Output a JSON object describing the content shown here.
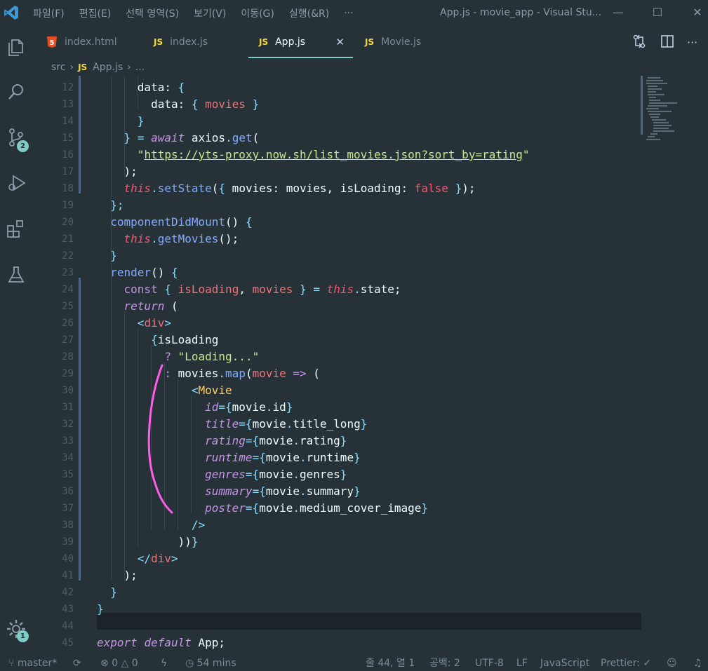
{
  "menu": [
    "파일(F)",
    "편집(E)",
    "선택 영역(S)",
    "보기(V)",
    "이동(G)",
    "실행(&R)",
    "···"
  ],
  "window_title": "App.js - movie_app - Visual Stu...",
  "window_controls": {
    "minimize": "—",
    "maximize": "☐",
    "close": "✕"
  },
  "activity_badges": {
    "source_control": "2",
    "settings": "1"
  },
  "tabs": [
    {
      "label": "index.html",
      "icon": "html5-icon"
    },
    {
      "label": "index.js",
      "icon": "js-icon",
      "icon_text": "JS"
    },
    {
      "label": "App.js",
      "icon": "js-icon",
      "icon_text": "JS",
      "active": true,
      "close": "✕"
    },
    {
      "label": "Movie.js",
      "icon": "js-icon",
      "icon_text": "JS"
    }
  ],
  "tab_more": "···",
  "breadcrumb": {
    "folder": "src",
    "sep1": "›",
    "icon_text": "JS",
    "file": "App.js",
    "sep2": "›",
    "more": "..."
  },
  "line_numbers": [
    "12",
    "13",
    "14",
    "15",
    "16",
    "17",
    "18",
    "19",
    "20",
    "21",
    "22",
    "23",
    "24",
    "25",
    "26",
    "27",
    "28",
    "29",
    "30",
    "31",
    "32",
    "33",
    "34",
    "35",
    "36",
    "37",
    "38",
    "39",
    "40",
    "41",
    "42",
    "43",
    "44",
    "45"
  ],
  "code": {
    "url": "https://yts-proxy.now.sh/list_movies.json?sort_by=rating",
    "loading": "\"Loading...\""
  },
  "status": {
    "branch": "master*",
    "errors": "0",
    "warnings": "0",
    "time": "54 mins",
    "position": "줄 44, 열 1",
    "spaces": "공백: 2",
    "encoding": "UTF-8",
    "eol": "LF",
    "language": "JavaScript",
    "formatter": "Prettier: ✓"
  },
  "colors": {
    "background": "#263238",
    "accent": "#80cbc4",
    "keyword": "#c792ea",
    "string": "#c3e88d",
    "function": "#82aaff",
    "variable": "#f07178"
  }
}
